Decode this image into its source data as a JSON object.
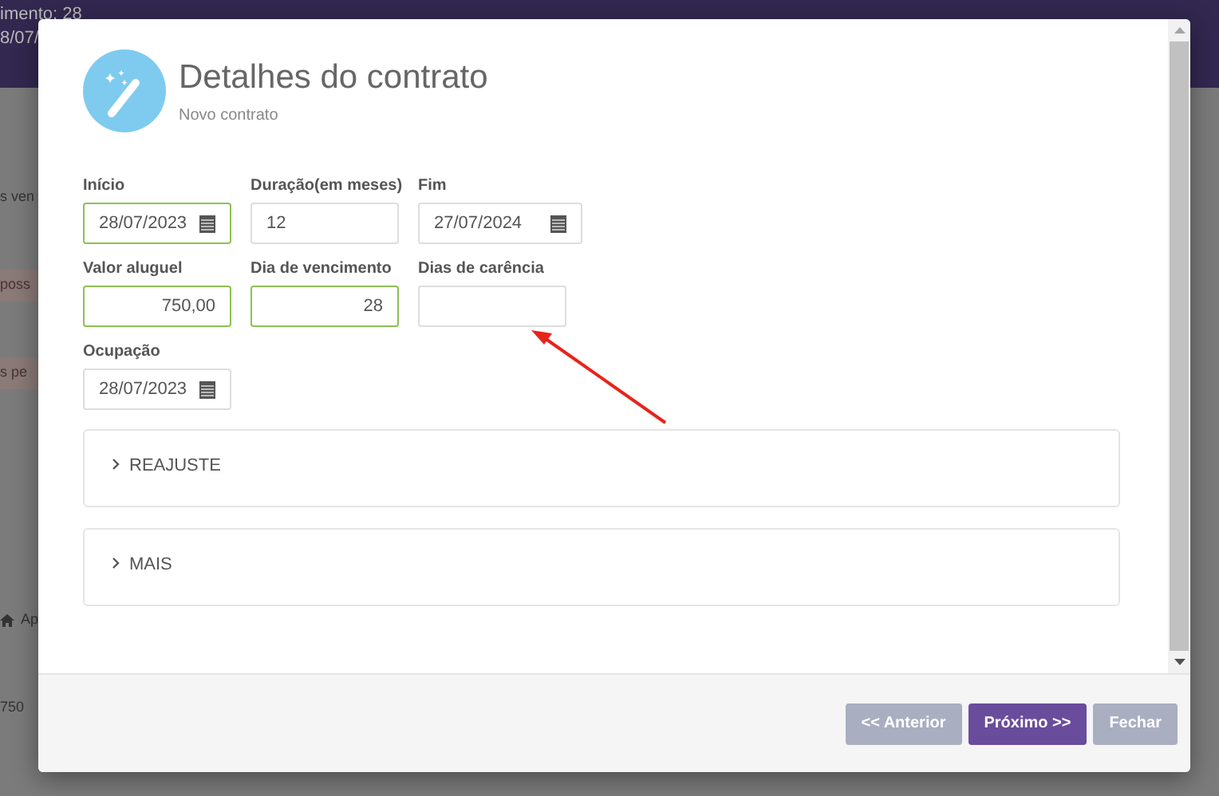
{
  "background": {
    "header_lines": [
      "imento: 28",
      "8/07/"
    ],
    "rows": [
      {
        "text": "s ven",
        "kind": "plain"
      },
      {
        "text": "poss",
        "kind": "alert"
      },
      {
        "text": "s pe",
        "kind": "alert"
      },
      {
        "text": "Ap",
        "kind": "home"
      },
      {
        "text": "750",
        "kind": "plain"
      }
    ]
  },
  "modal": {
    "title": "Detalhes do contrato",
    "subtitle": "Novo contrato",
    "fields": [
      {
        "label": "Início",
        "value": "28/07/2023",
        "kind": "date",
        "valid": true
      },
      {
        "label": "Duração(em meses)",
        "value": "12",
        "kind": "text",
        "valid": false
      },
      {
        "label": "Fim",
        "value": "27/07/2024",
        "kind": "date",
        "valid": false
      },
      {
        "label": "Valor aluguel",
        "value": "750,00",
        "kind": "number",
        "valid": true
      },
      {
        "label": "Dia de vencimento",
        "value": "28",
        "kind": "number",
        "valid": true
      },
      {
        "label": "Dias de carência",
        "kind": "number",
        "valid": false
      },
      {
        "label": "Ocupação",
        "value": "28/07/2023",
        "kind": "date",
        "valid": false
      }
    ],
    "sections": [
      {
        "label": "REAJUSTE",
        "expanded": false
      },
      {
        "label": "MAIS",
        "expanded": false
      }
    ],
    "buttons": [
      {
        "label": "<< Anterior",
        "kind": "secondary",
        "disabled": true
      },
      {
        "label": "Próximo >>",
        "kind": "primary",
        "disabled": false
      },
      {
        "label": "Fechar",
        "kind": "secondary",
        "disabled": true
      }
    ]
  }
}
